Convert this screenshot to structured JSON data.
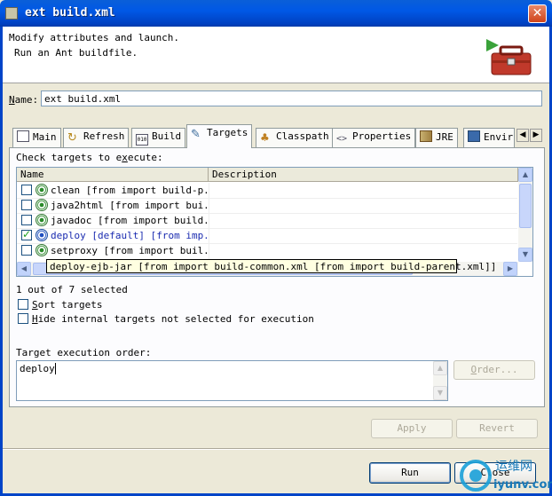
{
  "window": {
    "title": "ext build.xml",
    "close_glyph": "✕"
  },
  "header": {
    "line1": "Modify attributes and launch.",
    "line2": "Run an Ant buildfile.",
    "icon": "toolbox-run-icon"
  },
  "name_field": {
    "label_underlined": "N",
    "label_rest": "ame:",
    "value": "ext build.xml"
  },
  "tabs": [
    {
      "label": "Main",
      "icon": "main-tab-icon"
    },
    {
      "label": "Refresh",
      "icon": "refresh-icon"
    },
    {
      "label": "Build",
      "icon": "build-icon"
    },
    {
      "label": "Targets",
      "icon": "targets-icon",
      "active": true
    },
    {
      "label": "Classpath",
      "icon": "classpath-icon"
    },
    {
      "label": "Properties",
      "icon": "properties-icon"
    },
    {
      "label": "JRE",
      "icon": "jre-icon"
    },
    {
      "label": "Envir",
      "icon": "environment-icon"
    }
  ],
  "targets": {
    "check_label_pre": "Check targets to e",
    "check_label_ul": "x",
    "check_label_post": "ecute:",
    "columns": [
      "Name",
      "Description"
    ],
    "rows": [
      {
        "name": "clean [from import build-p...",
        "checked": false,
        "default": false
      },
      {
        "name": "java2html [from import bui...",
        "checked": false,
        "default": false
      },
      {
        "name": "javadoc [from import build...",
        "checked": false,
        "default": false
      },
      {
        "name": "deploy [default] [from imp...",
        "checked": true,
        "default": true
      },
      {
        "name": "setproxy [from import buil...",
        "checked": false,
        "default": false
      }
    ],
    "tooltip": "deploy-ejb-jar [from import build-common.xml [from import build-parent.xml]]",
    "selected_count": "1 out of 7 selected",
    "sort_label_ul": "S",
    "sort_label_rest": "ort targets",
    "hide_label_ul": "H",
    "hide_label_rest": "ide internal targets not selected for execution",
    "order_label": "Target execution order:",
    "order_value": "deploy",
    "order_button_ul": "O",
    "order_button_rest": "rder..."
  },
  "buttons": {
    "apply": "Apply",
    "apply_ul": "y",
    "revert": "Revert",
    "revert_ul": "v",
    "run": "Run",
    "run_ul": "R",
    "close": "Close"
  },
  "scroll": {
    "up": "▲",
    "down": "▼",
    "left": "◀",
    "right": "▶"
  },
  "watermark": {
    "text_cn": "运维网",
    "text_url": "iyunv.com"
  },
  "colors": {
    "title_bar": "#0058e6",
    "dialog_bg": "#ece9d8",
    "tooltip_bg": "#ffffe1"
  }
}
